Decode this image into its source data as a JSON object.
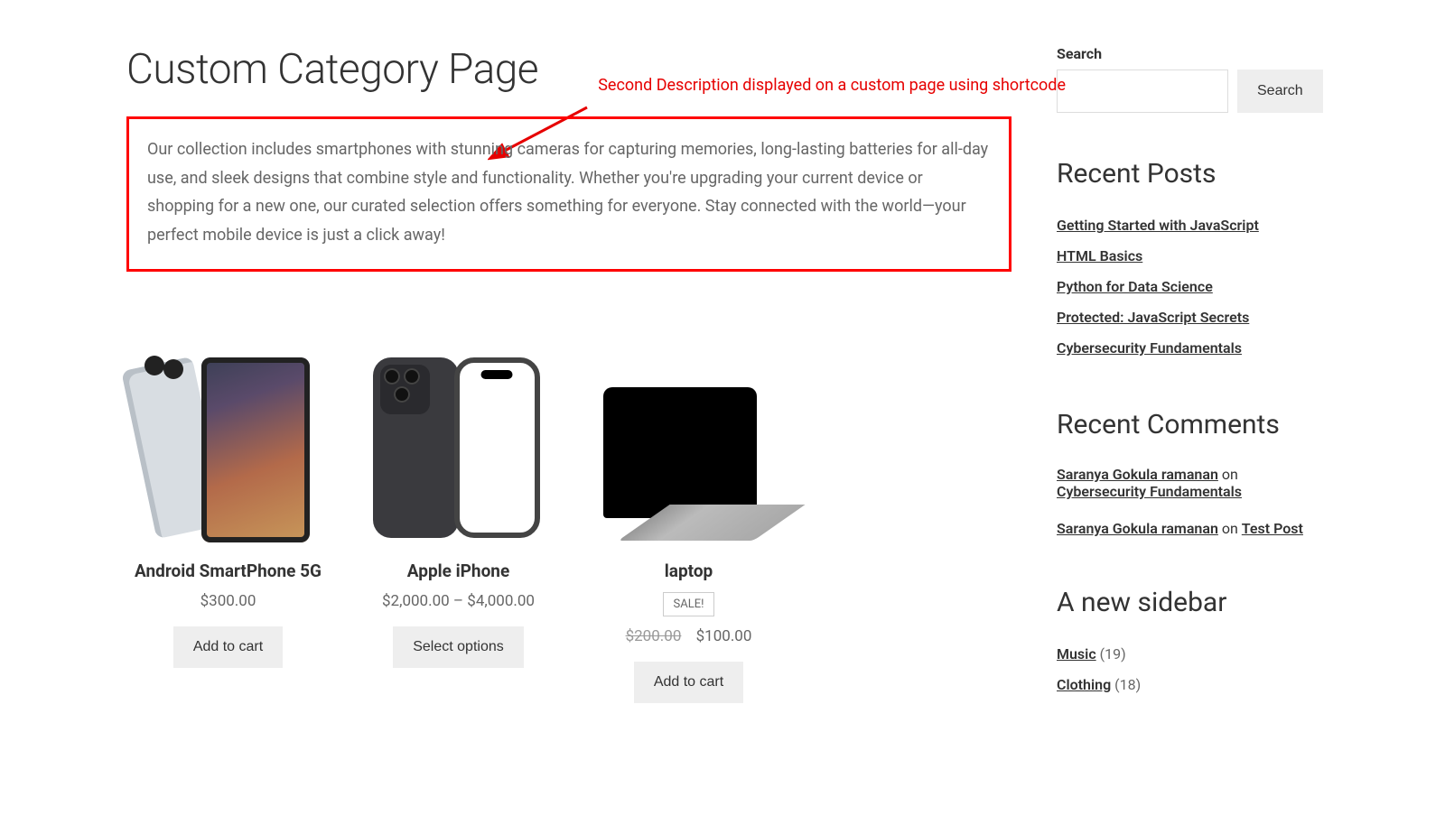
{
  "page_title": "Custom Category Page",
  "annotation": "Second Description displayed on a custom page using shortcode",
  "description": "Our collection includes smartphones with stunning cameras for capturing memories, long-lasting batteries for all-day use, and sleek designs that combine style and functionality. Whether you're upgrading your current device or shopping for a new one, our curated selection offers something for everyone. Stay connected with the world—your perfect mobile device is just a click away!",
  "products": [
    {
      "name": "Android SmartPhone 5G",
      "price": "$300.00",
      "button": "Add to cart"
    },
    {
      "name": "Apple iPhone",
      "price": "$2,000.00 – $4,000.00",
      "button": "Select options"
    },
    {
      "name": "laptop",
      "sale_badge": "SALE!",
      "old_price": "$200.00",
      "price": "$100.00",
      "button": "Add to cart"
    }
  ],
  "sidebar": {
    "search_label": "Search",
    "search_button": "Search",
    "recent_posts_title": "Recent Posts",
    "recent_posts": [
      "Getting Started with JavaScript",
      "HTML Basics",
      "Python for Data Science",
      "Protected: JavaScript Secrets",
      "Cybersecurity Fundamentals"
    ],
    "recent_comments_title": "Recent Comments",
    "recent_comments": [
      {
        "author": "Saranya Gokula ramanan",
        "on": "on",
        "post": "Cybersecurity Fundamentals"
      },
      {
        "author": "Saranya Gokula ramanan",
        "on": "on",
        "post": "Test Post"
      }
    ],
    "new_sidebar_title": "A new sidebar",
    "categories": [
      {
        "name": "Music",
        "count": "(19)"
      },
      {
        "name": "Clothing",
        "count": "(18)"
      }
    ]
  }
}
